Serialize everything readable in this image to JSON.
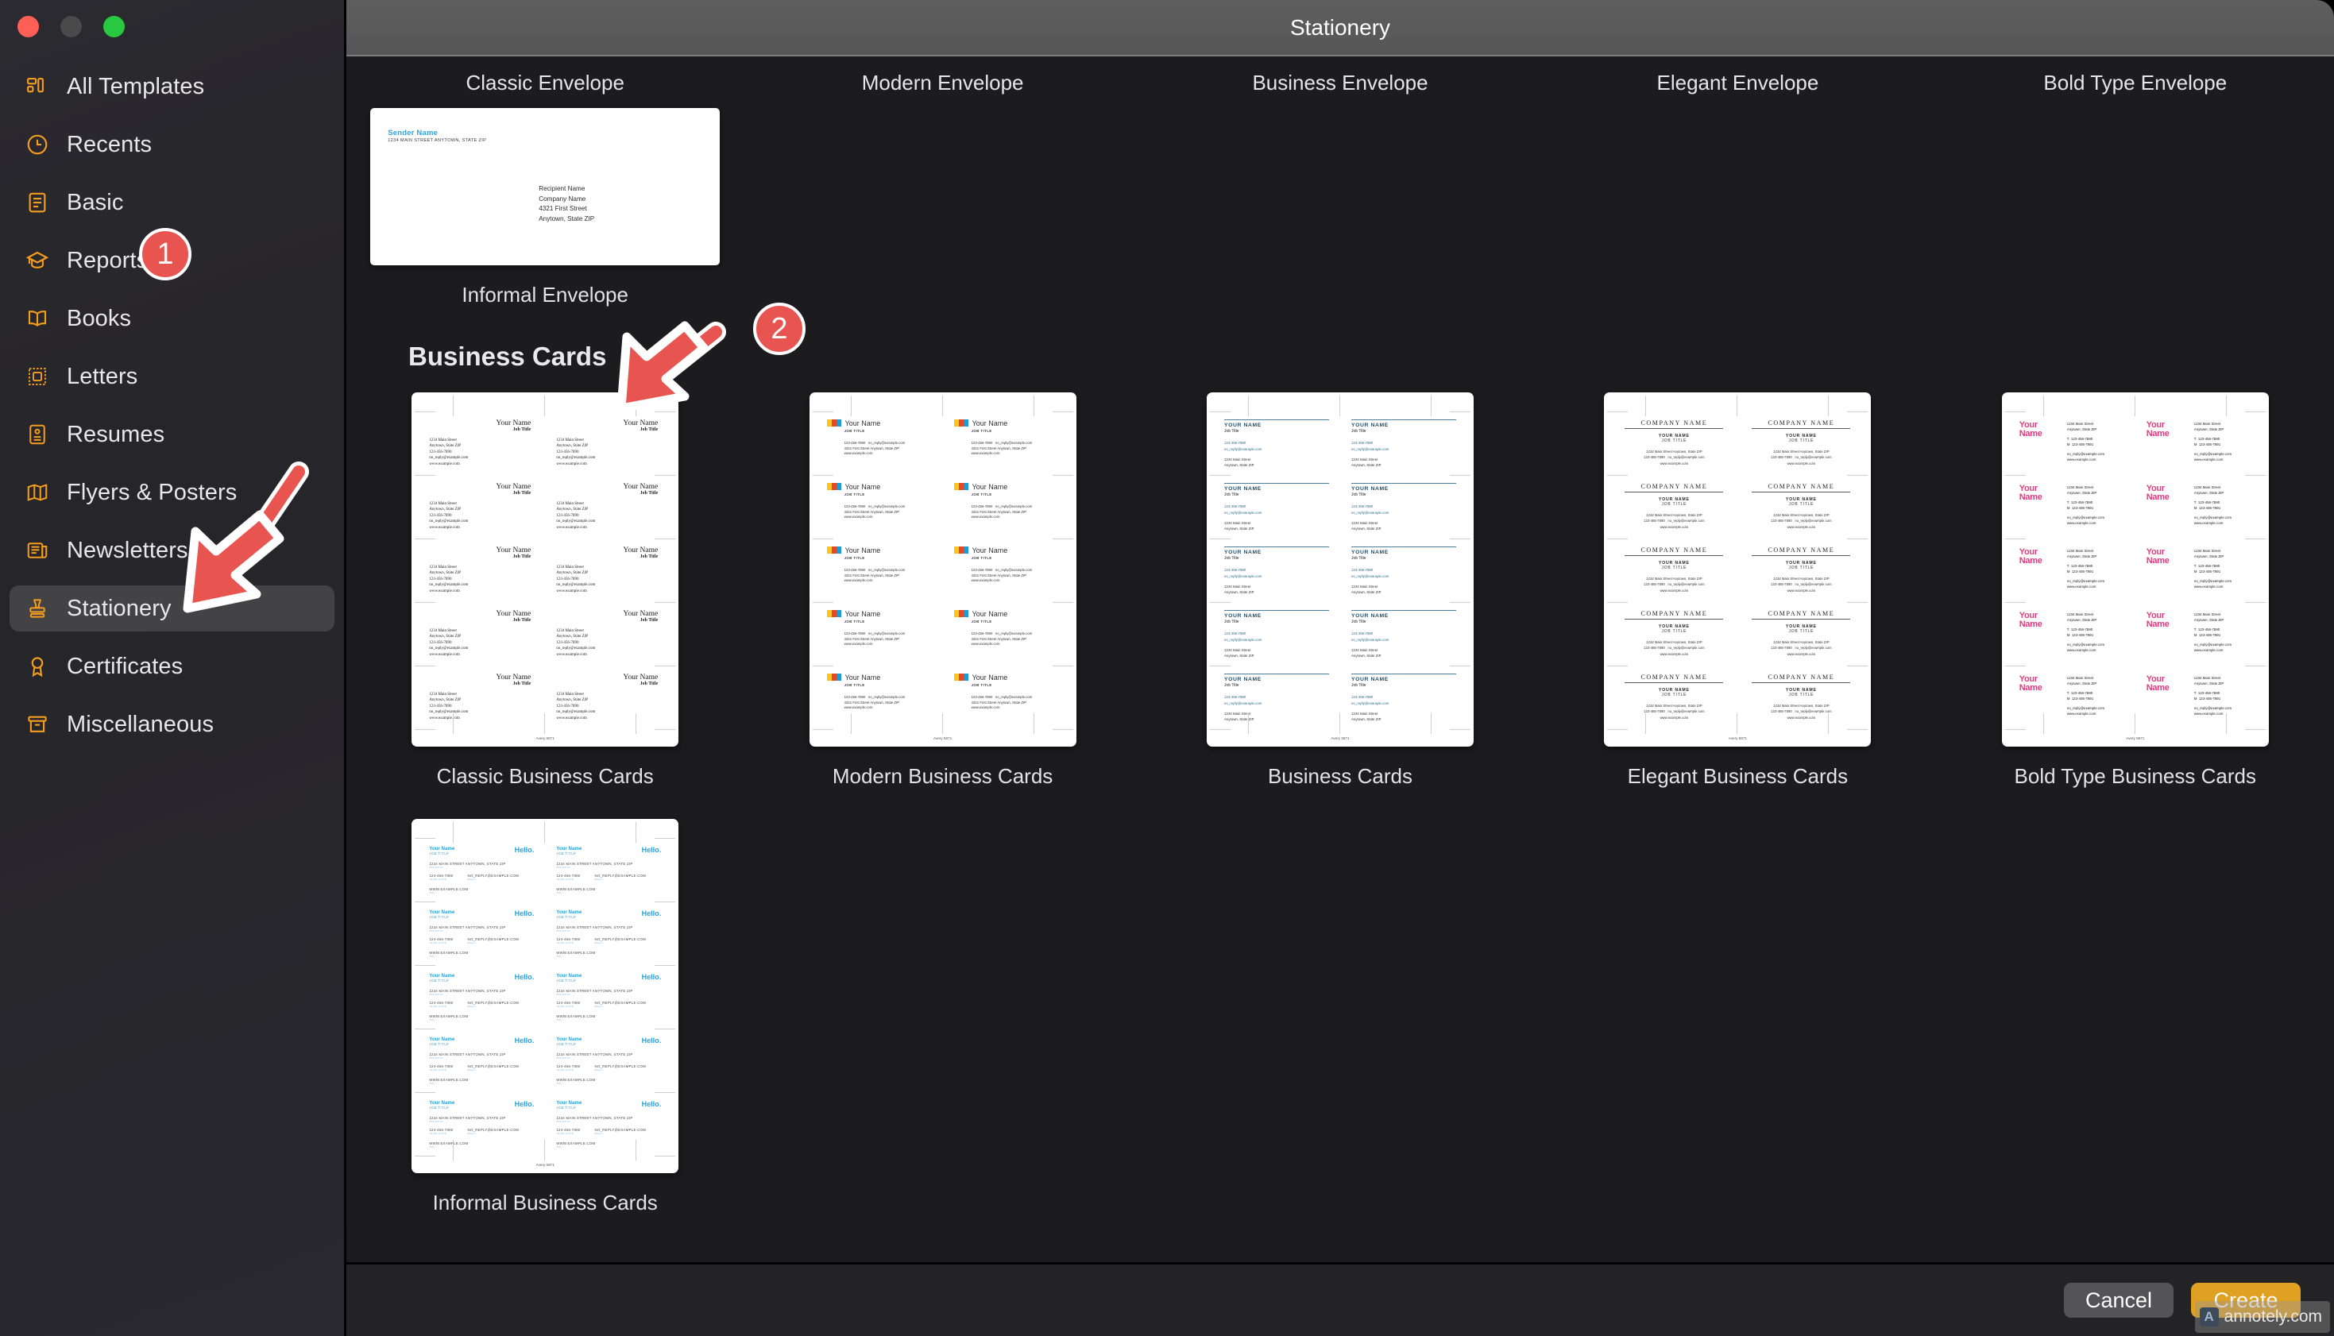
{
  "window": {
    "title": "Stationery",
    "traffic_lights": [
      "close-button",
      "minimize-button",
      "zoom-button"
    ]
  },
  "sidebar": {
    "items": [
      {
        "label": "All Templates",
        "icon": "grid-icon",
        "selected": false
      },
      {
        "label": "Recents",
        "icon": "clock-icon",
        "selected": false
      },
      {
        "label": "Basic",
        "icon": "document-icon",
        "selected": false
      },
      {
        "label": "Reports",
        "icon": "graduation-cap-icon",
        "selected": false
      },
      {
        "label": "Books",
        "icon": "open-book-icon",
        "selected": false
      },
      {
        "label": "Letters",
        "icon": "stamp-frame-icon",
        "selected": false
      },
      {
        "label": "Resumes",
        "icon": "resume-icon",
        "selected": false
      },
      {
        "label": "Flyers & Posters",
        "icon": "map-fold-icon",
        "selected": false
      },
      {
        "label": "Newsletters",
        "icon": "newspaper-icon",
        "selected": false
      },
      {
        "label": "Stationery",
        "icon": "rubber-stamp-icon",
        "selected": true
      },
      {
        "label": "Certificates",
        "icon": "award-ribbon-icon",
        "selected": false
      },
      {
        "label": "Miscellaneous",
        "icon": "archive-box-icon",
        "selected": false
      }
    ]
  },
  "envelopes": {
    "tabs": [
      "Classic Envelope",
      "Modern Envelope",
      "Business Envelope",
      "Elegant Envelope",
      "Bold Type Envelope"
    ],
    "thumbnail": {
      "label": "Informal Envelope",
      "sender_name": "Sender Name",
      "sender_address": "1234 MAIN STREET ANYTOWN, STATE ZIP",
      "recipient_lines": [
        "Recipient Name",
        "Company Name",
        "4321 First Street",
        "Anytown, State ZIP"
      ]
    }
  },
  "business_cards": {
    "section_title": "Business Cards",
    "items": [
      {
        "label": "Classic Business Cards",
        "style": "classic"
      },
      {
        "label": "Modern Business Cards",
        "style": "modern"
      },
      {
        "label": "Business Cards",
        "style": "biz"
      },
      {
        "label": "Elegant Business Cards",
        "style": "eleg"
      },
      {
        "label": "Bold Type Business Cards",
        "style": "bold"
      },
      {
        "label": "Informal Business Cards",
        "style": "inf"
      }
    ],
    "card_text": {
      "name": "Your Name",
      "name_caps": "YOUR NAME",
      "job_title": "Job Title",
      "job_title_caps": "JOB TITLE",
      "company": "COMPANY NAME",
      "hello": "Hello.",
      "street": "1234 Main Street",
      "street_caps": "1234 MAIN STREET ANYTOWN, STATE ZIP",
      "city": "Anytown, State ZIP",
      "phone": "123-456-7890",
      "mobile": "123-456-7891",
      "email": "no_reply@example.com",
      "email_caps": "NO_REPLY@EXAMPLE.COM",
      "web": "www.example.com",
      "web_caps": "WWW.EXAMPLE.COM",
      "street_full": "4321 First Street  Anytown, State  ZIP",
      "street_one_line": "1234 Main Street  Anytown, State ZIP",
      "label_address": "ADDRESS",
      "label_tel": "TELEPHONE",
      "label_email": "EMAIL",
      "label_url": "URL",
      "tel_prefix": "T",
      "mob_prefix": "M",
      "avery": "Avery 5871"
    }
  },
  "footer": {
    "cancel_label": "Cancel",
    "create_label": "Create"
  },
  "watermark": {
    "text": "annotely.com",
    "icon": "annotely-logo-icon"
  },
  "annotations": [
    {
      "number": "1",
      "target": "sidebar-item-stationery"
    },
    {
      "number": "2",
      "target": "business-cards-section-title"
    }
  ],
  "colors": {
    "accent_orange": "#f59e1e",
    "selected_row": "#434245",
    "create_button": "#e0a021",
    "annotation_red": "#e8544f",
    "sidebar_bg": "#2a2930",
    "content_bg": "#1c1c1e"
  }
}
